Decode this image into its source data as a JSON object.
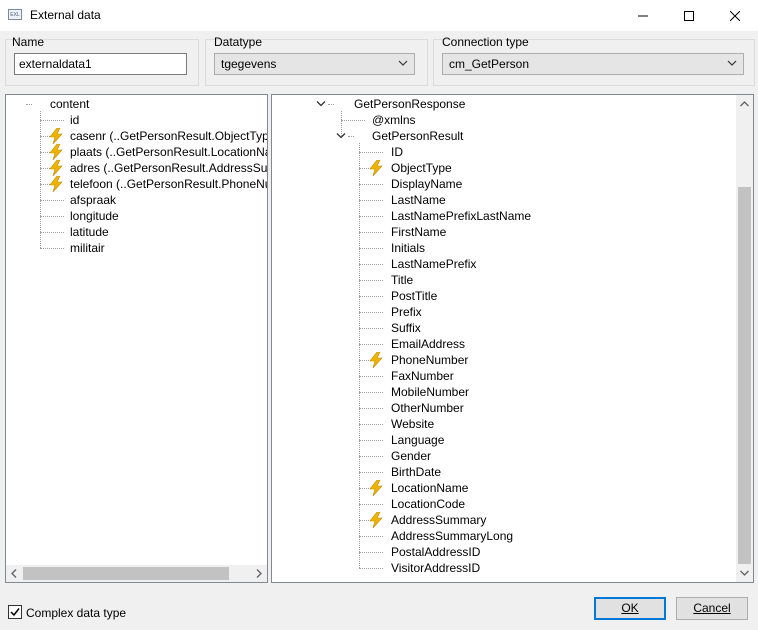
{
  "window": {
    "title": "External data",
    "app_icon_text": "EXL"
  },
  "name_group": {
    "label": "Name",
    "value": "externaldata1"
  },
  "datatype_group": {
    "label": "Datatype",
    "value": "tgegevens"
  },
  "connection_group": {
    "label": "Connection type",
    "value": "cm_GetPerson"
  },
  "left_tree": {
    "root": "content",
    "items": [
      {
        "label": "id",
        "bolt": false
      },
      {
        "label": "casenr (..GetPersonResult.ObjectType)",
        "bolt": true
      },
      {
        "label": "plaats (..GetPersonResult.LocationName)",
        "bolt": true
      },
      {
        "label": "adres (..GetPersonResult.AddressSummary)",
        "bolt": true
      },
      {
        "label": "telefoon (..GetPersonResult.PhoneNumber)",
        "bolt": true
      },
      {
        "label": "afspraak",
        "bolt": false
      },
      {
        "label": "longitude",
        "bolt": false
      },
      {
        "label": "latitude",
        "bolt": false
      },
      {
        "label": "militair",
        "bolt": false
      }
    ]
  },
  "right_tree": {
    "root": "GetPersonResponse",
    "xmlns": "@xmlns",
    "result": "GetPersonResult",
    "fields": [
      {
        "label": "ID",
        "bolt": false
      },
      {
        "label": "ObjectType",
        "bolt": true
      },
      {
        "label": "DisplayName",
        "bolt": false
      },
      {
        "label": "LastName",
        "bolt": false
      },
      {
        "label": "LastNamePrefixLastName",
        "bolt": false
      },
      {
        "label": "FirstName",
        "bolt": false
      },
      {
        "label": "Initials",
        "bolt": false
      },
      {
        "label": "LastNamePrefix",
        "bolt": false
      },
      {
        "label": "Title",
        "bolt": false
      },
      {
        "label": "PostTitle",
        "bolt": false
      },
      {
        "label": "Prefix",
        "bolt": false
      },
      {
        "label": "Suffix",
        "bolt": false
      },
      {
        "label": "EmailAddress",
        "bolt": false
      },
      {
        "label": "PhoneNumber",
        "bolt": true
      },
      {
        "label": "FaxNumber",
        "bolt": false
      },
      {
        "label": "MobileNumber",
        "bolt": false
      },
      {
        "label": "OtherNumber",
        "bolt": false
      },
      {
        "label": "Website",
        "bolt": false
      },
      {
        "label": "Language",
        "bolt": false
      },
      {
        "label": "Gender",
        "bolt": false
      },
      {
        "label": "BirthDate",
        "bolt": false
      },
      {
        "label": "LocationName",
        "bolt": true
      },
      {
        "label": "LocationCode",
        "bolt": false
      },
      {
        "label": "AddressSummary",
        "bolt": true
      },
      {
        "label": "AddressSummaryLong",
        "bolt": false
      },
      {
        "label": "PostalAddressID",
        "bolt": false
      },
      {
        "label": "VisitorAddressID",
        "bolt": false
      }
    ]
  },
  "footer": {
    "complex_label": "Complex data type",
    "complex_checked": true,
    "ok_label": "OK",
    "cancel_label": "Cancel"
  },
  "icons": {
    "mapped": "lightning-icon"
  },
  "colors": {
    "bolt": "#f0b400",
    "focus": "#0078d7"
  }
}
